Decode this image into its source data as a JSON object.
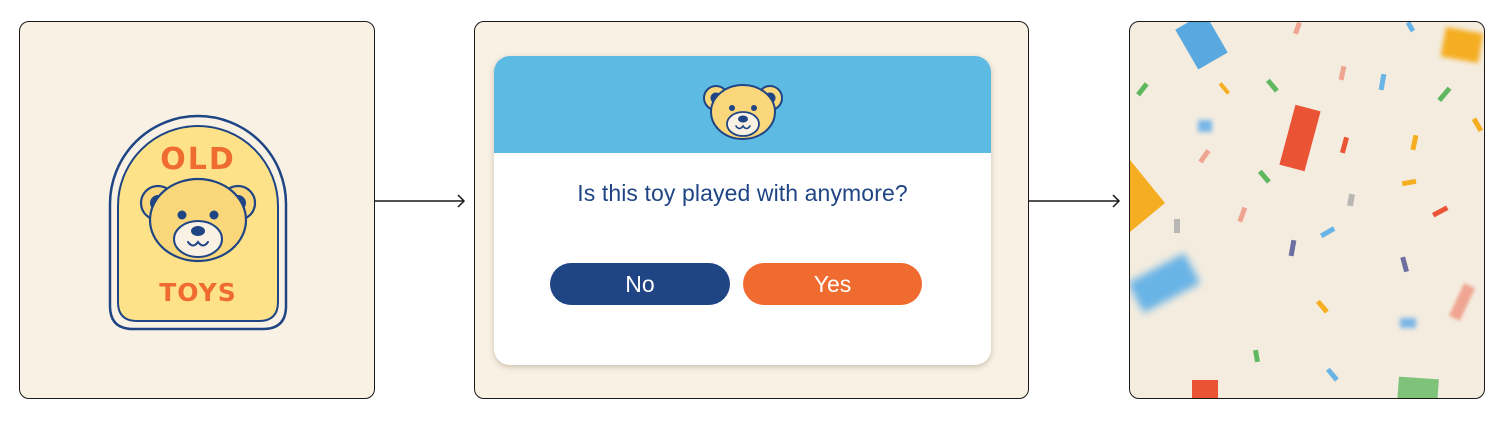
{
  "badge": {
    "top_text": "OLD",
    "bottom_text": "TOYS"
  },
  "dialog": {
    "question": "Is this toy played with anymore?",
    "no_label": "No",
    "yes_label": "Yes"
  },
  "colors": {
    "panel_bg": "#f8f1e4",
    "header_blue": "#5dbbe3",
    "navy": "#1f4585",
    "orange": "#f06b2f",
    "bear_yellow": "#fbd77c",
    "badge_yellow": "#fde28a"
  },
  "icons": [
    "teddy-bear-icon",
    "arrow-right-icon",
    "confetti"
  ]
}
